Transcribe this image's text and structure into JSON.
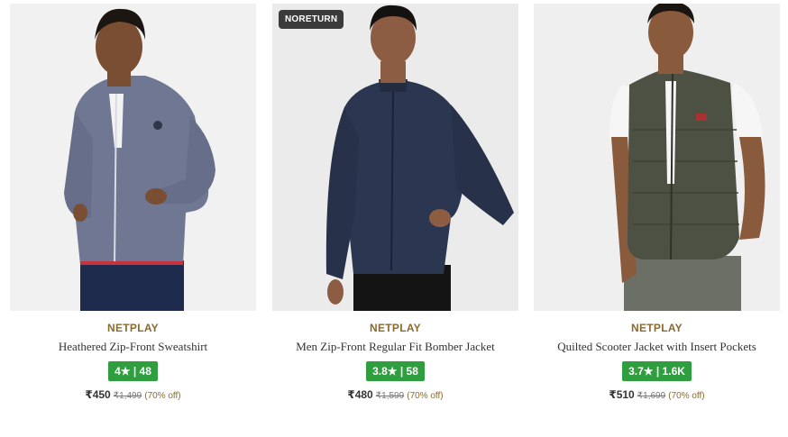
{
  "products": [
    {
      "badge": "",
      "brand": "NETPLAY",
      "name": "Heathered Zip-Front Sweatshirt",
      "rating": "4★ | 48",
      "price": "₹450",
      "mrp": "₹1,499",
      "discount": "(70% off)"
    },
    {
      "badge": "NORETURN",
      "brand": "NETPLAY",
      "name": "Men Zip-Front Regular Fit Bomber Jacket",
      "rating": "3.8★ | 58",
      "price": "₹480",
      "mrp": "₹1,599",
      "discount": "(70% off)"
    },
    {
      "badge": "",
      "brand": "NETPLAY",
      "name": "Quilted Scooter Jacket with Insert Pockets",
      "rating": "3.7★ | 1.6K",
      "price": "₹510",
      "mrp": "₹1,699",
      "discount": "(70% off)"
    }
  ],
  "colors": {
    "brand_text": "#8a6a2e",
    "rating_bg": "#2e9e3e",
    "badge_bg": "#3b3b3b"
  }
}
